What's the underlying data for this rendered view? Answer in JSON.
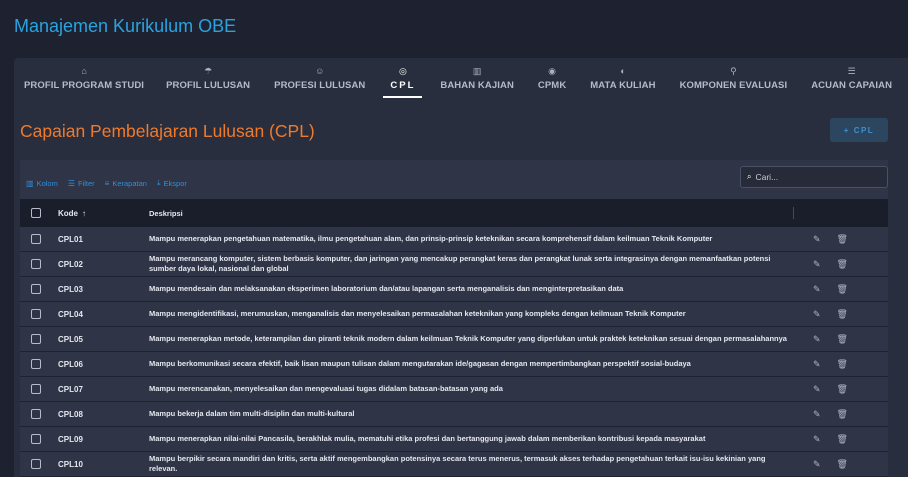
{
  "app": {
    "title": "Manajemen Kurikulum OBE"
  },
  "tabs": [
    {
      "label": "PROFIL PROGRAM STUDI",
      "icon": "building-icon",
      "glyph": "⌂",
      "active": false
    },
    {
      "label": "PROFIL LULUSAN",
      "icon": "graduation-cap-icon",
      "glyph": "☂",
      "active": false
    },
    {
      "label": "PROFESI LULUSAN",
      "icon": "worker-icon",
      "glyph": "☺",
      "active": false
    },
    {
      "label": "CPL",
      "icon": "target-icon",
      "glyph": "◎",
      "active": true
    },
    {
      "label": "BAHAN KAJIAN",
      "icon": "library-icon",
      "glyph": "▥",
      "active": false
    },
    {
      "label": "CPMK",
      "icon": "crosshair-icon",
      "glyph": "◉",
      "active": false
    },
    {
      "label": "MATA KULIAH",
      "icon": "book-icon",
      "glyph": "◐",
      "active": false
    },
    {
      "label": "KOMPONEN EVALUASI",
      "icon": "hierarchy-icon",
      "glyph": "⚲",
      "active": false
    },
    {
      "label": "ACUAN CAPAIAN",
      "icon": "document-search-icon",
      "glyph": "☰",
      "active": false
    }
  ],
  "section": {
    "title": "Capaian Pembelajaran Lulusan (CPL)",
    "add_label": "+ CPL"
  },
  "toolbar": {
    "columns": "Kolom",
    "filter": "Filter",
    "density": "Kerapatan",
    "export": "Ekspor"
  },
  "search": {
    "placeholder": "Cari..."
  },
  "table": {
    "headers": {
      "code": "Kode",
      "desc": "Deskripsi"
    },
    "rows": [
      {
        "code": "CPL01",
        "desc": "Mampu menerapkan pengetahuan matematika, ilmu pengetahuan alam, dan prinsip-prinsip keteknikan secara komprehensif dalam keilmuan Teknik Komputer"
      },
      {
        "code": "CPL02",
        "desc": "Mampu merancang komputer, sistem berbasis komputer, dan jaringan yang mencakup perangkat keras dan perangkat lunak serta integrasinya dengan memanfaatkan potensi sumber daya lokal, nasional dan global"
      },
      {
        "code": "CPL03",
        "desc": "Mampu mendesain dan melaksanakan eksperimen laboratorium dan/atau lapangan serta menganalisis dan menginterpretasikan data"
      },
      {
        "code": "CPL04",
        "desc": "Mampu mengidentifikasi, merumuskan, menganalisis dan menyelesaikan permasalahan keteknikan yang kompleks dengan keilmuan Teknik Komputer"
      },
      {
        "code": "CPL05",
        "desc": "Mampu menerapkan metode, keterampilan dan piranti teknik modern dalam keilmuan Teknik Komputer yang diperlukan untuk praktek keteknikan sesuai dengan permasalahannya"
      },
      {
        "code": "CPL06",
        "desc": "Mampu berkomunikasi secara efektif, baik lisan maupun tulisan dalam mengutarakan ide/gagasan dengan mempertimbangkan perspektif sosial-budaya"
      },
      {
        "code": "CPL07",
        "desc": "Mampu merencanakan, menyelesaikan dan mengevaluasi tugas didalam batasan-batasan yang ada"
      },
      {
        "code": "CPL08",
        "desc": "Mampu bekerja dalam tim multi-disiplin dan multi-kultural"
      },
      {
        "code": "CPL09",
        "desc": "Mampu menerapkan nilai-nilai Pancasila, berakhlak mulia, mematuhi etika profesi dan bertanggung jawab dalam memberikan kontribusi kepada masyarakat"
      },
      {
        "code": "CPL10",
        "desc": "Mampu berpikir secara mandiri dan kritis, serta aktif mengembangkan potensinya secara terus menerus, termasuk akses terhadap pengetahuan terkait isu-isu kekinian yang relevan."
      }
    ]
  },
  "colors": {
    "brand": "#29a3e0",
    "section_title": "#f07a2a",
    "accent": "#2f8fd8"
  }
}
